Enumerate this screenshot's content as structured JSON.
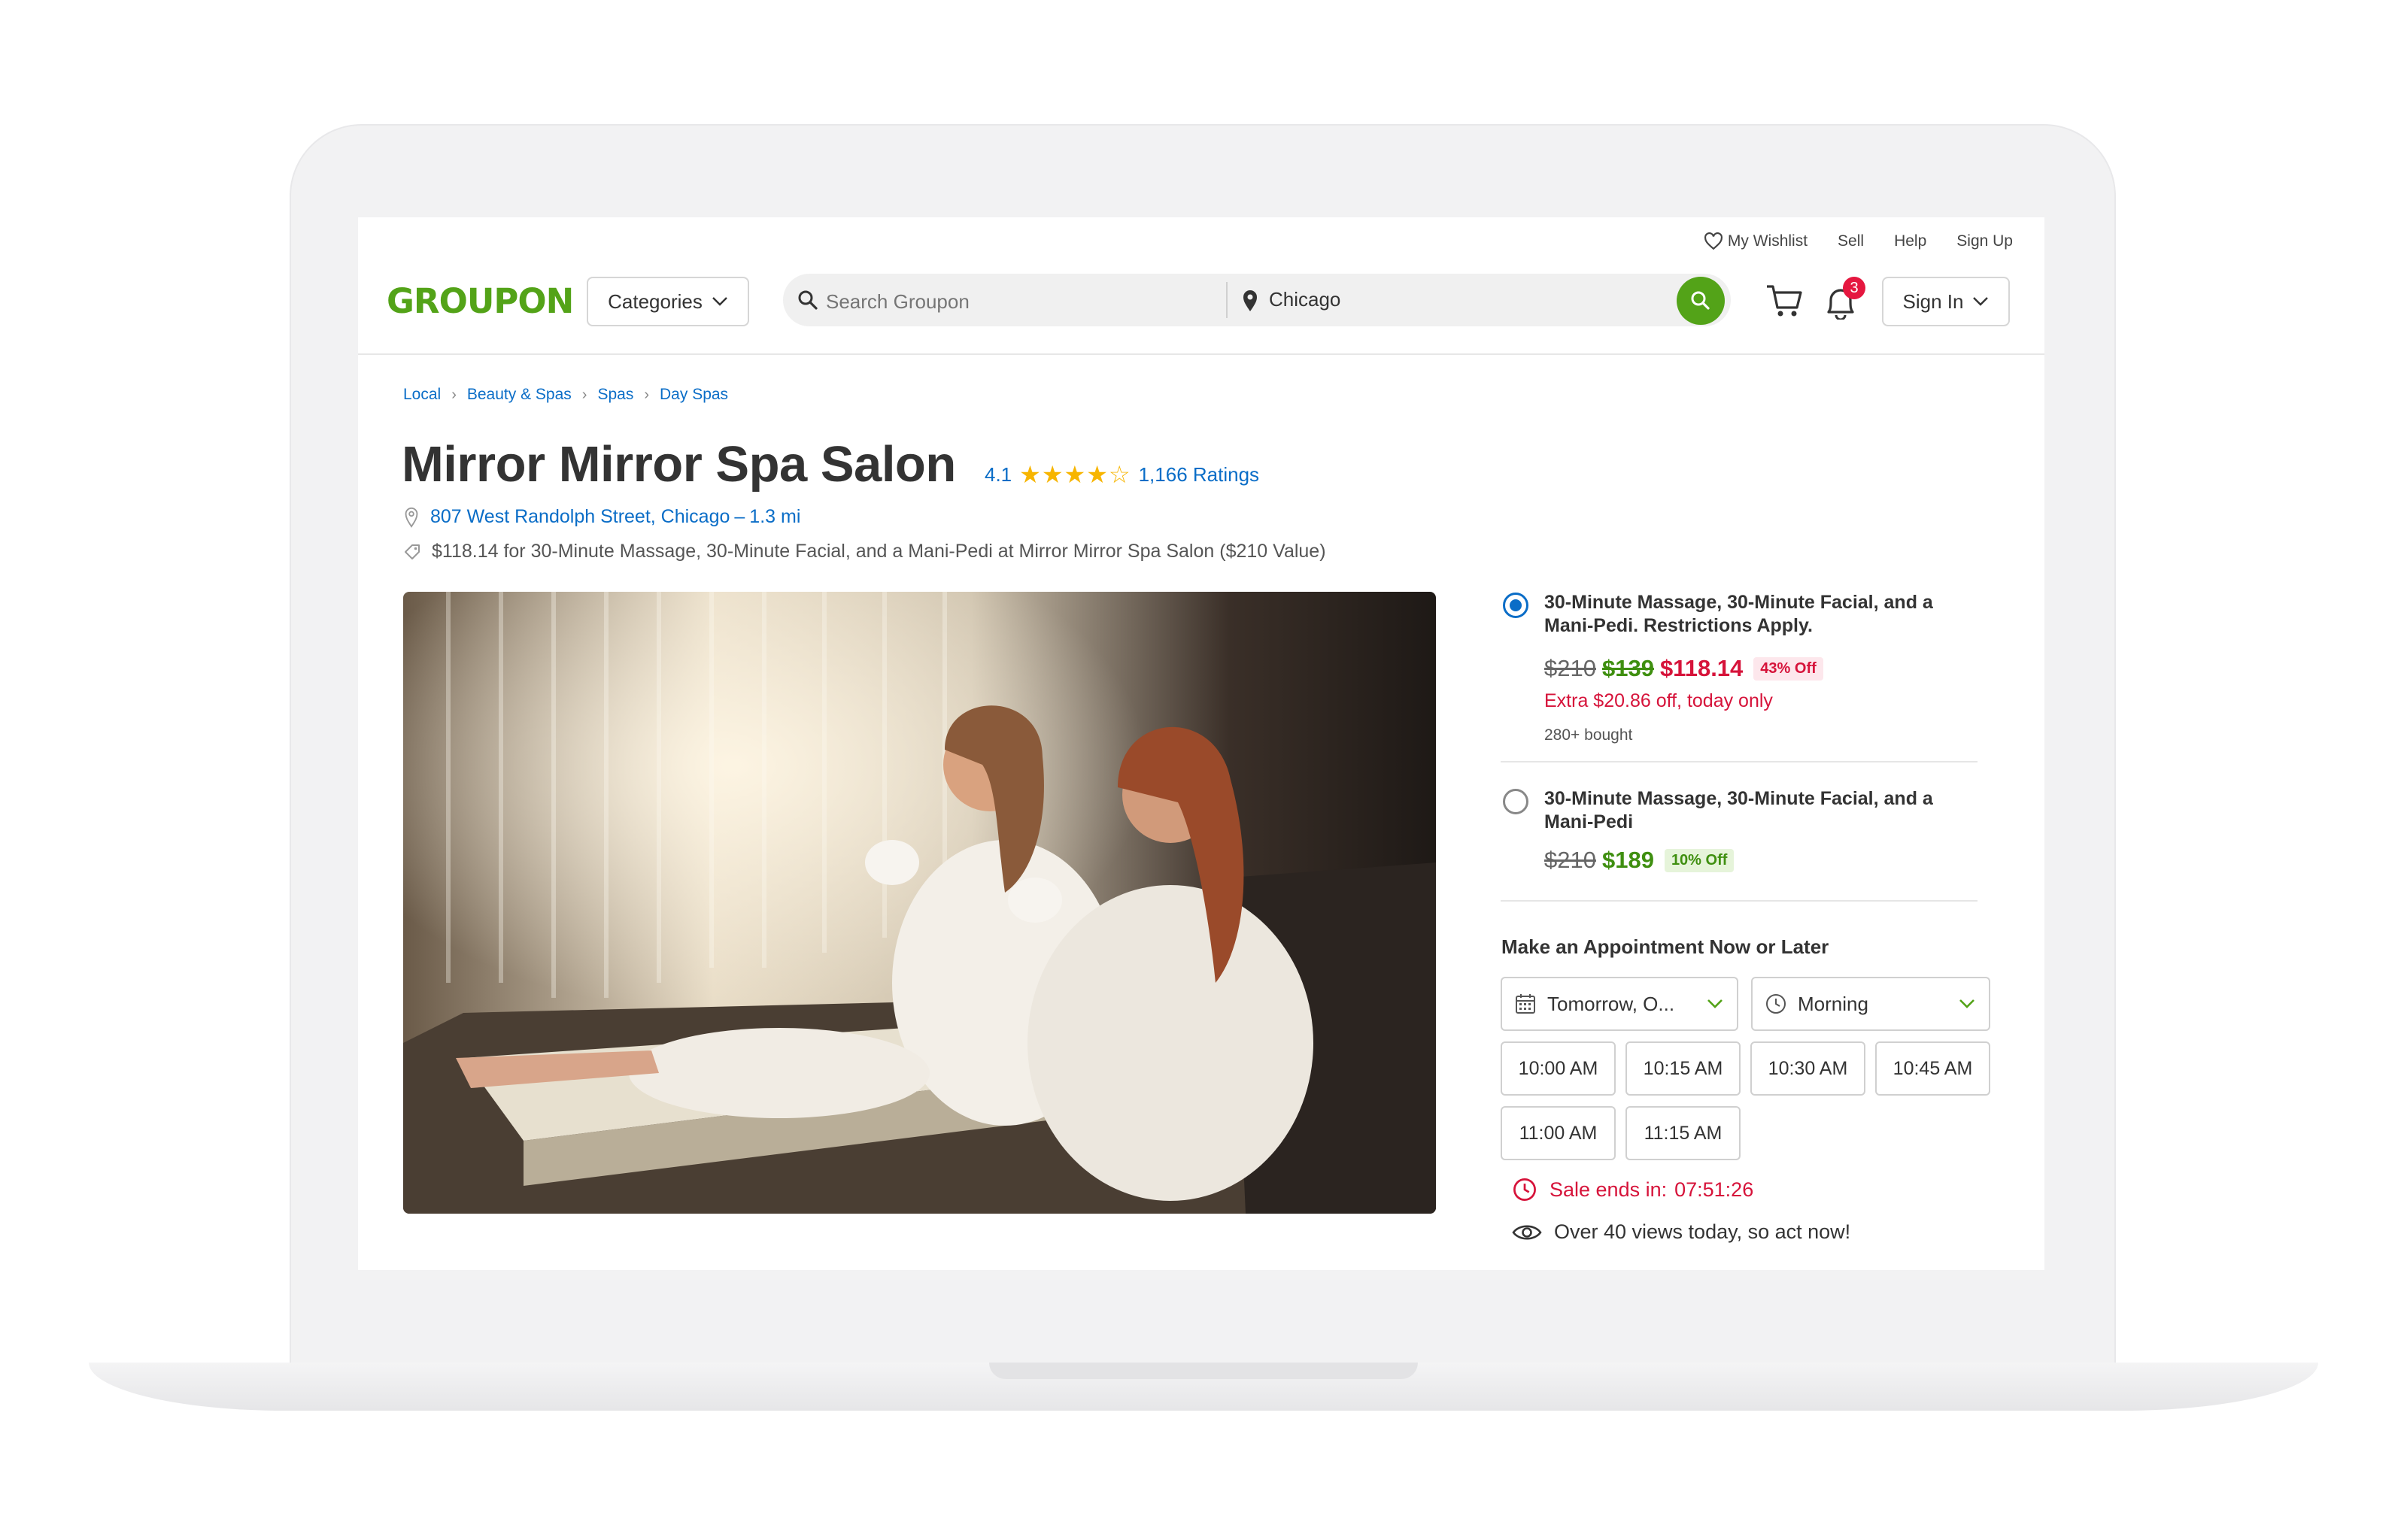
{
  "header": {
    "logo": "GROUPON",
    "util_links": {
      "wishlist": "My Wishlist",
      "sell": "Sell",
      "help": "Help",
      "signup": "Sign Up"
    },
    "categories_label": "Categories",
    "search_placeholder": "Search Groupon",
    "location_value": "Chicago",
    "notification_count": "3",
    "signin_label": "Sign In"
  },
  "breadcrumbs": [
    "Local",
    "Beauty & Spas",
    "Spas",
    "Day Spas"
  ],
  "deal": {
    "title": "Mirror Mirror Spa Salon",
    "rating": "4.1",
    "rating_value": 4.1,
    "ratings_count": "1,166 Ratings",
    "address": "807 West Randolph Street, Chicago",
    "distance": "1.3 mi",
    "description": "$118.14 for 30-Minute Massage, 30-Minute Facial, and a Mani-Pedi at Mirror Mirror Spa Salon ($210 Value)"
  },
  "options": [
    {
      "title": "30-Minute Massage, 30-Minute Facial, and a Mani-Pedi. Restrictions Apply.",
      "original": "$210",
      "price": "$139",
      "sale_price": "$118.14",
      "badge": "43% Off",
      "extra": "Extra $20.86 off, today only",
      "bought": "280+ bought",
      "selected": true
    },
    {
      "title": "30-Minute Massage, 30-Minute Facial, and a Mani-Pedi",
      "original": "$210",
      "price": "$189",
      "badge": "10% Off",
      "selected": false
    }
  ],
  "appointment": {
    "heading": "Make an Appointment Now or Later",
    "date_value": "Tomorrow, O...",
    "time_value": "Morning",
    "slots": [
      "10:00 AM",
      "10:15 AM",
      "10:30 AM",
      "10:45 AM",
      "11:00 AM",
      "11:15 AM"
    ]
  },
  "urgency": {
    "sale_label": "Sale ends in:",
    "countdown": "07:51:26",
    "views": "Over 40 views today, so act now!"
  },
  "colors": {
    "brand": "#53a318",
    "link": "#0a6dc7",
    "sale": "#d6133a"
  }
}
